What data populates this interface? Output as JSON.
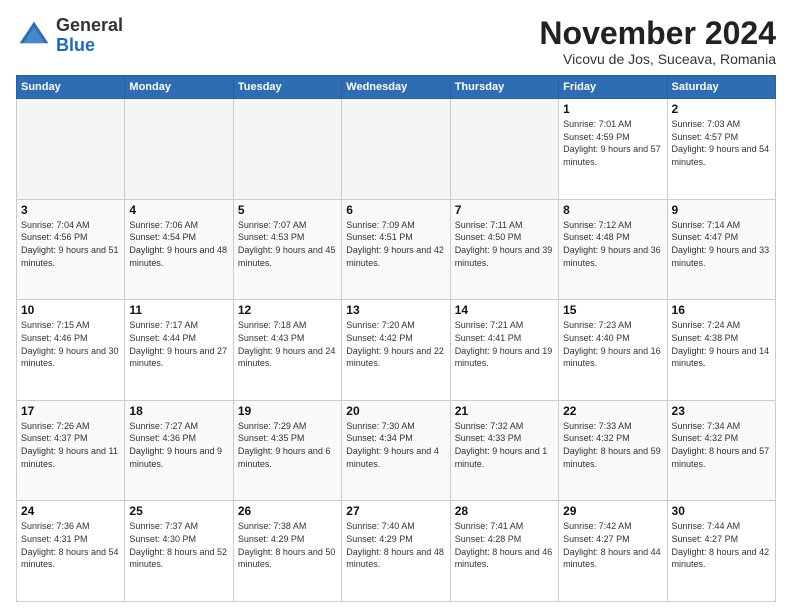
{
  "header": {
    "logo_general": "General",
    "logo_blue": "Blue",
    "month_title": "November 2024",
    "location": "Vicovu de Jos, Suceava, Romania"
  },
  "weekdays": [
    "Sunday",
    "Monday",
    "Tuesday",
    "Wednesday",
    "Thursday",
    "Friday",
    "Saturday"
  ],
  "weeks": [
    [
      {
        "day": "",
        "info": ""
      },
      {
        "day": "",
        "info": ""
      },
      {
        "day": "",
        "info": ""
      },
      {
        "day": "",
        "info": ""
      },
      {
        "day": "",
        "info": ""
      },
      {
        "day": "1",
        "info": "Sunrise: 7:01 AM\nSunset: 4:59 PM\nDaylight: 9 hours and 57 minutes."
      },
      {
        "day": "2",
        "info": "Sunrise: 7:03 AM\nSunset: 4:57 PM\nDaylight: 9 hours and 54 minutes."
      }
    ],
    [
      {
        "day": "3",
        "info": "Sunrise: 7:04 AM\nSunset: 4:56 PM\nDaylight: 9 hours and 51 minutes."
      },
      {
        "day": "4",
        "info": "Sunrise: 7:06 AM\nSunset: 4:54 PM\nDaylight: 9 hours and 48 minutes."
      },
      {
        "day": "5",
        "info": "Sunrise: 7:07 AM\nSunset: 4:53 PM\nDaylight: 9 hours and 45 minutes."
      },
      {
        "day": "6",
        "info": "Sunrise: 7:09 AM\nSunset: 4:51 PM\nDaylight: 9 hours and 42 minutes."
      },
      {
        "day": "7",
        "info": "Sunrise: 7:11 AM\nSunset: 4:50 PM\nDaylight: 9 hours and 39 minutes."
      },
      {
        "day": "8",
        "info": "Sunrise: 7:12 AM\nSunset: 4:48 PM\nDaylight: 9 hours and 36 minutes."
      },
      {
        "day": "9",
        "info": "Sunrise: 7:14 AM\nSunset: 4:47 PM\nDaylight: 9 hours and 33 minutes."
      }
    ],
    [
      {
        "day": "10",
        "info": "Sunrise: 7:15 AM\nSunset: 4:46 PM\nDaylight: 9 hours and 30 minutes."
      },
      {
        "day": "11",
        "info": "Sunrise: 7:17 AM\nSunset: 4:44 PM\nDaylight: 9 hours and 27 minutes."
      },
      {
        "day": "12",
        "info": "Sunrise: 7:18 AM\nSunset: 4:43 PM\nDaylight: 9 hours and 24 minutes."
      },
      {
        "day": "13",
        "info": "Sunrise: 7:20 AM\nSunset: 4:42 PM\nDaylight: 9 hours and 22 minutes."
      },
      {
        "day": "14",
        "info": "Sunrise: 7:21 AM\nSunset: 4:41 PM\nDaylight: 9 hours and 19 minutes."
      },
      {
        "day": "15",
        "info": "Sunrise: 7:23 AM\nSunset: 4:40 PM\nDaylight: 9 hours and 16 minutes."
      },
      {
        "day": "16",
        "info": "Sunrise: 7:24 AM\nSunset: 4:38 PM\nDaylight: 9 hours and 14 minutes."
      }
    ],
    [
      {
        "day": "17",
        "info": "Sunrise: 7:26 AM\nSunset: 4:37 PM\nDaylight: 9 hours and 11 minutes."
      },
      {
        "day": "18",
        "info": "Sunrise: 7:27 AM\nSunset: 4:36 PM\nDaylight: 9 hours and 9 minutes."
      },
      {
        "day": "19",
        "info": "Sunrise: 7:29 AM\nSunset: 4:35 PM\nDaylight: 9 hours and 6 minutes."
      },
      {
        "day": "20",
        "info": "Sunrise: 7:30 AM\nSunset: 4:34 PM\nDaylight: 9 hours and 4 minutes."
      },
      {
        "day": "21",
        "info": "Sunrise: 7:32 AM\nSunset: 4:33 PM\nDaylight: 9 hours and 1 minute."
      },
      {
        "day": "22",
        "info": "Sunrise: 7:33 AM\nSunset: 4:32 PM\nDaylight: 8 hours and 59 minutes."
      },
      {
        "day": "23",
        "info": "Sunrise: 7:34 AM\nSunset: 4:32 PM\nDaylight: 8 hours and 57 minutes."
      }
    ],
    [
      {
        "day": "24",
        "info": "Sunrise: 7:36 AM\nSunset: 4:31 PM\nDaylight: 8 hours and 54 minutes."
      },
      {
        "day": "25",
        "info": "Sunrise: 7:37 AM\nSunset: 4:30 PM\nDaylight: 8 hours and 52 minutes."
      },
      {
        "day": "26",
        "info": "Sunrise: 7:38 AM\nSunset: 4:29 PM\nDaylight: 8 hours and 50 minutes."
      },
      {
        "day": "27",
        "info": "Sunrise: 7:40 AM\nSunset: 4:29 PM\nDaylight: 8 hours and 48 minutes."
      },
      {
        "day": "28",
        "info": "Sunrise: 7:41 AM\nSunset: 4:28 PM\nDaylight: 8 hours and 46 minutes."
      },
      {
        "day": "29",
        "info": "Sunrise: 7:42 AM\nSunset: 4:27 PM\nDaylight: 8 hours and 44 minutes."
      },
      {
        "day": "30",
        "info": "Sunrise: 7:44 AM\nSunset: 4:27 PM\nDaylight: 8 hours and 42 minutes."
      }
    ]
  ]
}
